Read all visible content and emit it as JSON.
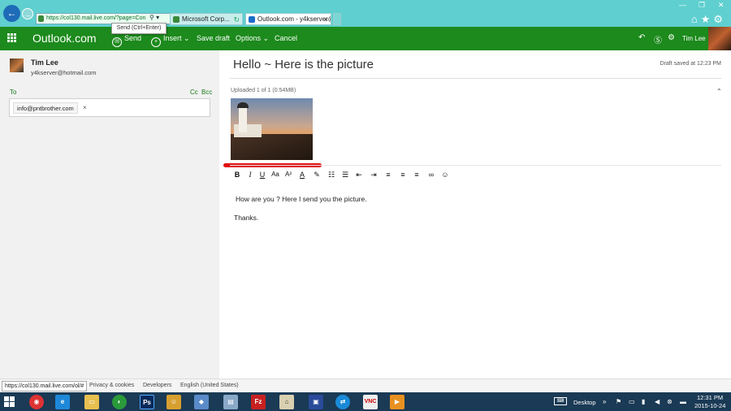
{
  "browser": {
    "address": "https://col130.mail.live.com/?page=Con",
    "tabs": [
      {
        "label": "Microsoft Corp..."
      },
      {
        "label": "Outlook.com - y4kserver@h..."
      }
    ]
  },
  "outlook_bar": {
    "brand": "Outlook.com",
    "send_label": "Send",
    "insert_label": "Insert",
    "save_draft_label": "Save draft",
    "options_label": "Options",
    "cancel_label": "Cancel",
    "user_name": "Tim Lee",
    "send_tooltip": "Send (Ctrl+Enter)"
  },
  "sender": {
    "name": "Tim Lee",
    "email": "y4kserver@hotmail.com"
  },
  "recipients": {
    "to_label": "To",
    "cc_label": "Cc",
    "bcc_label": "Bcc",
    "to": [
      "info@pntbrother.com"
    ]
  },
  "message": {
    "subject": "Hello ~ Here is the picture",
    "draft_status": "Draft saved at 12:23 PM",
    "attachments_status": "Uploaded 1 of 1 (0.54MB)",
    "body_lines": [
      "How are you ? Here I send you the picture.",
      "Thanks."
    ]
  },
  "footer": {
    "status_url": "https://col130.mail.live.com/ol/#",
    "links": [
      "Privacy & cookies",
      "Developers",
      "English (United States)"
    ]
  },
  "taskbar": {
    "desktop_label": "Desktop",
    "time": "12:31 PM",
    "date": "2015-10-24"
  },
  "colors": {
    "outlook_green": "#1c8a1c",
    "browser_chrome": "#5fcfcf",
    "taskbar": "#1a3a55",
    "annotation_red": "#e01010"
  }
}
